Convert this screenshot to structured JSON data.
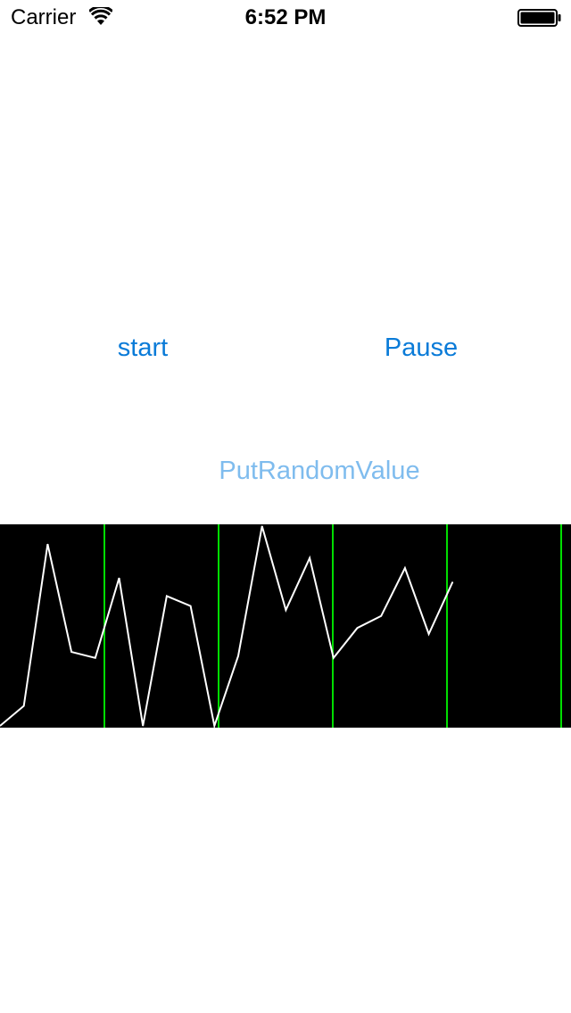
{
  "status_bar": {
    "carrier": "Carrier",
    "time": "6:52 PM",
    "icons": [
      "wifi-icon",
      "battery-icon"
    ]
  },
  "controls": {
    "start_label": "start",
    "pause_label": "Pause",
    "random_label": "PutRandomValue"
  },
  "colors": {
    "button_text": "#0a7bd8",
    "button_text_disabled": "#7fbcee",
    "graph_background": "#000000",
    "graph_line": "#ffffff",
    "grid_line": "#00dd00"
  },
  "chart_data": {
    "type": "line",
    "grid": true,
    "series": [
      {
        "values": [
          0.0,
          0.1,
          0.91,
          0.37,
          0.34,
          0.74,
          0.0,
          0.65,
          0.6,
          0.0,
          0.35,
          1.0,
          0.58,
          0.84,
          0.34,
          0.49,
          0.55,
          0.79,
          0.46,
          0.72
        ]
      }
    ],
    "ylim": [
      0,
      1
    ]
  }
}
